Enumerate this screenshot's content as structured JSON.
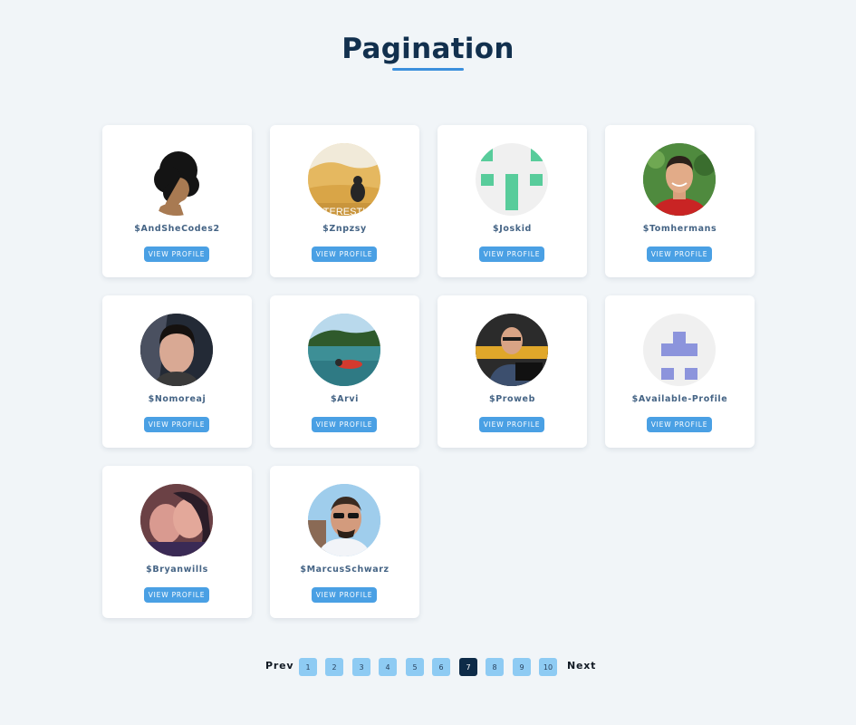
{
  "header": {
    "title": "Pagination"
  },
  "cards": [
    {
      "username": "$AndSheCodes2",
      "button": "VIEW PROFILE",
      "avatar": "afro-hair-silhouette-avatar"
    },
    {
      "username": "$Znpzsy",
      "button": "VIEW PROFILE",
      "avatar": "cat-on-couch-avatar",
      "avatar_text": "TERESTI"
    },
    {
      "username": "$Joskid",
      "button": "VIEW PROFILE",
      "avatar": "green-identicon-avatar"
    },
    {
      "username": "$Tomhermans",
      "button": "VIEW PROFILE",
      "avatar": "man-red-shirt-avatar"
    },
    {
      "username": "$Nomoreaj",
      "button": "VIEW PROFILE",
      "avatar": "man-portrait-avatar"
    },
    {
      "username": "$Arvi",
      "button": "VIEW PROFILE",
      "avatar": "snorkeling-photo-avatar"
    },
    {
      "username": "$Proweb",
      "button": "VIEW PROFILE",
      "avatar": "man-with-laptop-avatar"
    },
    {
      "username": "$Available-Profile",
      "button": "VIEW PROFILE",
      "avatar": "purple-identicon-avatar"
    },
    {
      "username": "$Bryanwills",
      "button": "VIEW PROFILE",
      "avatar": "couple-selfie-avatar"
    },
    {
      "username": "$MarcusSchwarz",
      "button": "VIEW PROFILE",
      "avatar": "man-sunglasses-avatar"
    }
  ],
  "pagination": {
    "prev": "Prev",
    "next": "Next",
    "pages": [
      "1",
      "2",
      "3",
      "4",
      "5",
      "6",
      "7",
      "8",
      "9",
      "10"
    ],
    "current": "7"
  },
  "colors": {
    "background": "#f1f5f8",
    "title": "#12304e",
    "accent": "#4aa0e4",
    "page_button": "#8ecbf3",
    "page_active": "#0d2b48"
  }
}
